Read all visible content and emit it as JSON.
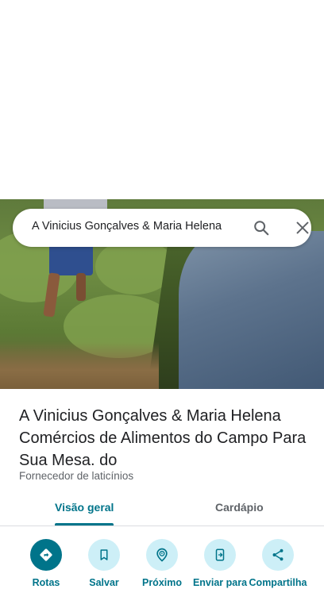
{
  "search": {
    "query": "A Vinicius Gonçalves & Maria Helena"
  },
  "place": {
    "title": "A Vinicius Gonçalves & Maria Helena Comércios de Alimentos do Campo Para Sua Mesa. do",
    "category": "Fornecedor de laticínios"
  },
  "tabs": [
    {
      "label": "Visão geral",
      "selected": true
    },
    {
      "label": "Cardápio",
      "selected": false
    }
  ],
  "actions": [
    {
      "label": "Rotas",
      "icon": "directions-icon"
    },
    {
      "label": "Salvar",
      "icon": "bookmark-icon"
    },
    {
      "label": "Próximo",
      "icon": "nearby-icon"
    },
    {
      "label": "Enviar para",
      "icon": "send-to-phone-icon"
    },
    {
      "label": "Compartilha",
      "icon": "share-icon"
    }
  ],
  "colors": {
    "accent": "#00748a",
    "accent_light": "#cdeff7",
    "text_primary": "#202124",
    "text_secondary": "#5f6368"
  }
}
